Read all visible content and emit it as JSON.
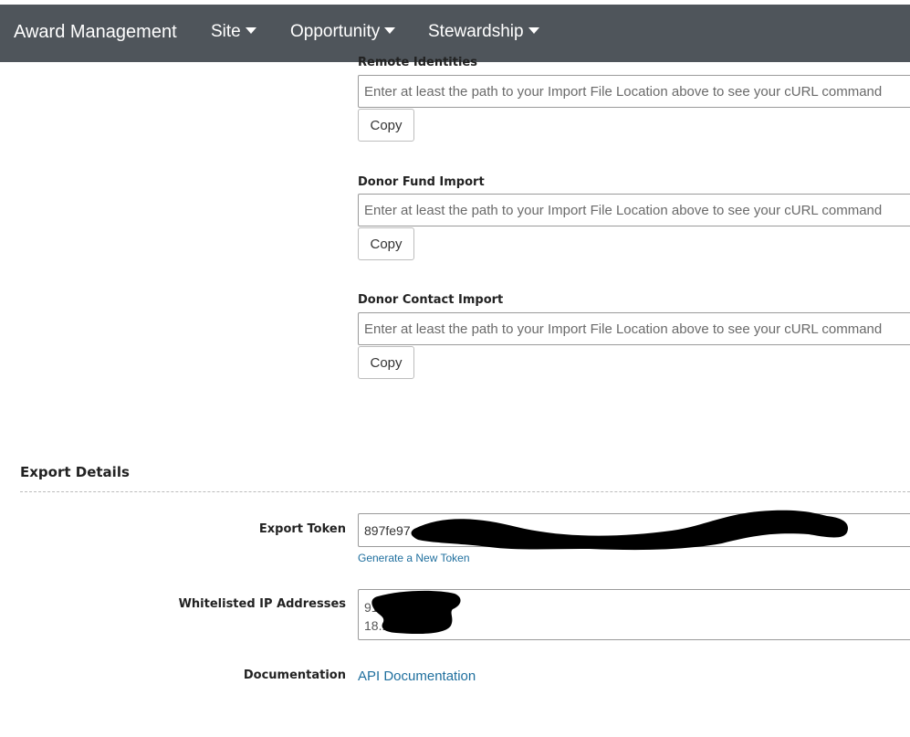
{
  "navbar": {
    "brand": "Award Management",
    "items": [
      {
        "label": "Site"
      },
      {
        "label": "Opportunity"
      },
      {
        "label": "Stewardship"
      }
    ]
  },
  "imports": [
    {
      "label": "Remote Identities",
      "placeholder": "Enter at least the path to your Import File Location above to see your cURL command",
      "button": "Copy"
    },
    {
      "label": "Donor Fund Import",
      "placeholder": "Enter at least the path to your Import File Location above to see your cURL command",
      "button": "Copy"
    },
    {
      "label": "Donor Contact Import",
      "placeholder": "Enter at least the path to your Import File Location above to see your cURL command",
      "button": "Copy"
    }
  ],
  "export": {
    "title": "Export Details",
    "token_label": "Export Token",
    "token_value": "897fe97",
    "generate_link": "Generate a New Token",
    "whitelist_label": "Whitelisted IP Addresses",
    "whitelist_value": "91\n18.1",
    "documentation_label": "Documentation",
    "documentation_link": "API Documentation"
  },
  "colors": {
    "navbar_bg": "#4f555b",
    "link": "#1f6f9e",
    "redaction": "#000000"
  }
}
